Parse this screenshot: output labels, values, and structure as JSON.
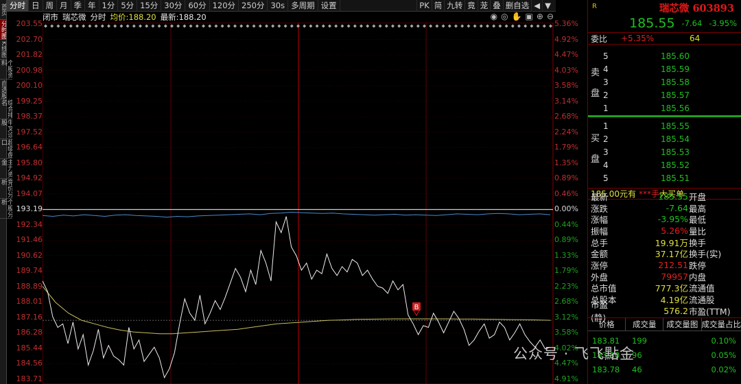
{
  "left_tabs": [
    "首页",
    "分时图",
    "K线图",
    "个股资料",
    "自选股",
    "综合排名",
    "牛叉诊股",
    "超级盘口",
    "主力资金",
    "竞价分析",
    "个股分析"
  ],
  "toolbar": {
    "items": [
      "分时",
      "日",
      "周",
      "月",
      "季",
      "年",
      "1分",
      "5分",
      "15分",
      "30分",
      "60分",
      "120分",
      "250分",
      "30s",
      "多周期",
      "设置"
    ],
    "right": [
      "PK",
      "简",
      "九转",
      "竟",
      "茏",
      "叠",
      "删自选",
      "◀",
      "▼"
    ]
  },
  "infobar": {
    "status": "闭市",
    "stock": "瑞芯微",
    "mode": "分时",
    "avg_label": "均价:",
    "avg_value": "188.20",
    "last_label": "最新:",
    "last_value": "188.20"
  },
  "info_icons": [
    "eye-icon",
    "eye-icon",
    "hand-icon",
    "lock-icon",
    "plus-icon",
    "minus-icon"
  ],
  "y_left": [
    "203.55",
    "202.70",
    "201.82",
    "200.98",
    "200.10",
    "199.25",
    "198.37",
    "197.52",
    "196.64",
    "195.80",
    "194.92",
    "194.07",
    "193.19",
    "192.34",
    "191.46",
    "190.62",
    "189.74",
    "188.89",
    "188.01",
    "187.16",
    "186.28",
    "185.44",
    "184.56",
    "183.71"
  ],
  "y_right": [
    "5.36%",
    "4.92%",
    "4.47%",
    "4.03%",
    "3.58%",
    "3.14%",
    "2.68%",
    "2.24%",
    "1.79%",
    "1.35%",
    "0.89%",
    "0.46%",
    "0.00%",
    "0.44%",
    "0.89%",
    "1.33%",
    "1.79%",
    "2.23%",
    "2.68%",
    "3.12%",
    "3.58%",
    "4.02%",
    "4.47%",
    "4.91%"
  ],
  "chart_data": {
    "type": "line",
    "prev_close": 193.19,
    "ylim": [
      183.71,
      203.55
    ],
    "series": [
      {
        "name": "价格",
        "values": [
          189.2,
          188.6,
          187.2,
          186.6,
          186.8,
          185.7,
          186.9,
          185.4,
          186.2,
          184.5,
          185.3,
          186.5,
          184.9,
          185.6,
          185.0,
          184.8,
          184.5,
          186.6,
          185.4,
          185.9,
          184.7,
          185.1,
          185.5,
          184.9,
          183.8,
          184.3,
          185.2,
          186.8,
          188.2,
          187.4,
          187.0,
          188.4,
          186.8,
          187.4,
          188.1,
          187.6,
          188.3,
          189.1,
          189.9,
          189.4,
          188.6,
          189.8,
          189.0,
          190.9,
          190.2,
          189.2,
          192.5,
          191.9,
          192.8,
          191.1,
          190.6,
          189.8,
          190.2,
          189.3,
          189.8,
          189.6,
          190.7,
          189.9,
          189.5,
          190.0,
          189.7,
          190.4,
          190.2,
          189.5,
          189.8,
          189.3,
          188.9,
          188.8,
          188.5,
          189.2,
          188.7,
          189.0,
          187.3,
          186.8,
          186.2,
          186.7,
          186.6,
          187.4,
          186.9,
          186.3,
          186.9,
          187.5,
          187.1,
          186.5,
          185.6,
          185.9,
          186.4,
          186.8,
          186.0,
          186.2,
          186.9,
          186.6,
          185.9,
          186.3,
          186.8,
          186.2,
          185.8,
          185.5,
          185.9,
          185.4,
          185.5
        ]
      },
      {
        "name": "均价",
        "values": [
          188.9,
          188.0,
          187.4,
          187.0,
          186.8,
          186.6,
          186.45,
          186.35,
          186.3,
          186.25,
          186.25,
          186.3,
          186.35,
          186.4,
          186.45,
          186.5,
          186.6,
          186.7,
          186.8,
          186.85,
          186.9,
          186.95,
          187.0,
          187.02,
          187.05,
          187.06,
          187.07,
          187.08,
          187.08,
          187.08,
          187.08,
          187.08,
          187.07,
          187.07,
          187.06,
          187.05,
          187.04,
          187.03,
          187.02,
          187.0
        ]
      },
      {
        "name": "指数",
        "values": [
          0.4,
          0.5,
          0.35,
          0.45,
          0.3,
          0.4,
          0.5,
          0.35,
          0.3,
          0.4,
          0.45,
          0.5,
          0.6,
          0.5,
          0.55,
          0.45,
          0.4,
          0.35,
          0.3,
          0.25,
          0.2,
          0.3,
          0.15,
          0.1,
          0.0,
          0.05,
          0.1,
          0.15,
          0.1,
          0.2,
          0.25,
          0.3,
          0.35,
          0.3,
          0.25,
          0.35,
          0.3,
          0.35,
          0.4,
          0.3,
          0.2,
          0.25,
          0.3,
          0.2,
          0.15,
          0.2,
          0.3,
          0.25,
          0.2,
          0.3
        ]
      }
    ],
    "marker_label": "B"
  },
  "right_panel": {
    "r_label": "R",
    "name": "瑞芯微",
    "code": "603893",
    "price": "185.55",
    "change": "-7.64",
    "pct": "-3.95%",
    "weibi_label": "委比",
    "weibi_value": "+5.35%",
    "weibi_count": "64",
    "sell_label": [
      "卖",
      "盘"
    ],
    "buy_label": [
      "买",
      "盘"
    ],
    "sell_levels": [
      [
        "5",
        "185.60"
      ],
      [
        "4",
        "185.59"
      ],
      [
        "3",
        "185.58"
      ],
      [
        "2",
        "185.57"
      ],
      [
        "1",
        "185.56"
      ]
    ],
    "buy_levels": [
      [
        "1",
        "185.55"
      ],
      [
        "2",
        "185.54"
      ],
      [
        "3",
        "185.53"
      ],
      [
        "4",
        "185.52"
      ],
      [
        "5",
        "185.51"
      ]
    ],
    "trade_line": {
      "price": "185.00元有",
      "qty": "***手",
      "label": "大买单"
    },
    "stats": [
      [
        "最新",
        "185.55",
        "grn",
        "开盘"
      ],
      [
        "涨跌",
        "-7.64",
        "grn",
        "最高"
      ],
      [
        "涨幅",
        "-3.95%",
        "grn",
        "最低"
      ],
      [
        "振幅",
        "5.26%",
        "red",
        "量比"
      ],
      [
        "总手",
        "19.91万",
        "ylw",
        "换手"
      ],
      [
        "金额",
        "37.17亿",
        "ylw",
        "换手(实)"
      ],
      [
        "涨停",
        "212.51",
        "red",
        "跌停"
      ],
      [
        "外盘",
        "79957",
        "red",
        "内盘"
      ],
      [
        "总市值",
        "777.3亿",
        "ylw",
        "流通值"
      ],
      [
        "总股本",
        "4.19亿",
        "ylw",
        "流通股"
      ],
      [
        "市盈(静)",
        "576.2",
        "ylw",
        "市盈(TTM)"
      ]
    ],
    "tick_headers": [
      "价格",
      "成交量",
      "成交量图",
      "成交量占比"
    ],
    "ticks": [
      [
        "183.81",
        "199",
        "0.10%"
      ],
      [
        "183.80",
        "96",
        "0.05%"
      ],
      [
        "183.78",
        "46",
        "0.02%"
      ]
    ]
  },
  "watermark": "公众号 · 飞飞點金"
}
